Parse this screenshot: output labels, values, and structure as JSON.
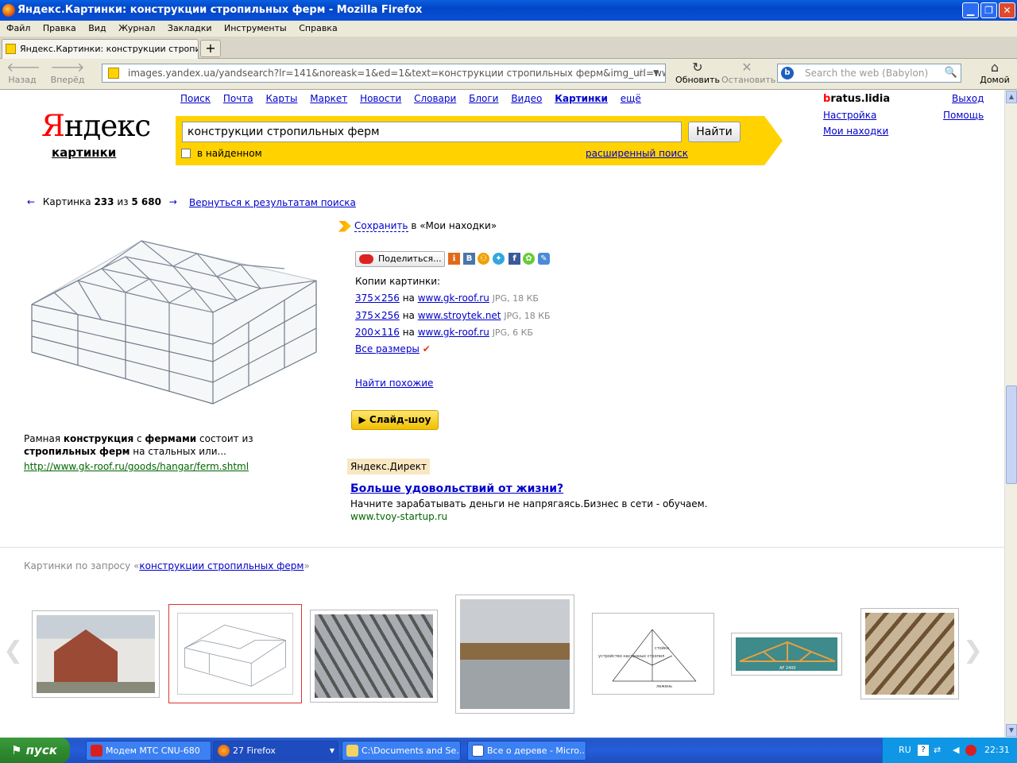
{
  "window": {
    "title": "Яндекс.Картинки: конструкции стропильных ферм - Mozilla Firefox",
    "minimize": "▁",
    "maximize": "❐",
    "close": "✕"
  },
  "menu": [
    "Файл",
    "Правка",
    "Вид",
    "Журнал",
    "Закладки",
    "Инструменты",
    "Справка"
  ],
  "tab": {
    "label": "Яндекс.Картинки: конструкции стропиль...",
    "new_tab": "+"
  },
  "toolbar": {
    "back": "Назад",
    "forward": "Вперёд",
    "reload": "Обновить",
    "stop": "Остановить",
    "home": "Домой",
    "url": "images.yandex.ua/yandsearch?lr=141&noreask=1&ed=1&text=конструкции стропильных ферм&img_url=ww",
    "search_placeholder": "Search the web (Babylon)"
  },
  "yandex": {
    "logo_first": "Я",
    "logo_rest": "ндекс",
    "logo_sub": "картинки",
    "nav": [
      "Поиск",
      "Почта",
      "Карты",
      "Маркет",
      "Новости",
      "Словари",
      "Блоги",
      "Видео",
      "Картинки",
      "ещё"
    ],
    "nav_active_index": 8,
    "query": "конструкции стропильных ферм",
    "search_button": "Найти",
    "in_found": "в найденном",
    "advanced": "расширенный поиск",
    "user_first": "b",
    "user_rest": "ratus.lidia",
    "exit": "Выход",
    "settings": "Настройка",
    "help": "Помощь",
    "my_finds": "Мои находки"
  },
  "viewer": {
    "prev_arrow": "←",
    "next_arrow": "→",
    "counter_label": "Картинка",
    "current": "233",
    "of": "из",
    "total": "5 680",
    "back_link": "Вернуться к результатам поиска",
    "desc_html": "Рамная <b>конструкция</b> с <b>фермами</b> состоит из <b>стропильных ферм</b> на стальных или...",
    "source_url": "http://www.gk-roof.ru/goods/hangar/ferm.shtml",
    "save_link": "Сохранить",
    "save_rest": "в «Мои находки»",
    "share": "Поделиться...",
    "copies_title": "Копии картинки:",
    "copies": [
      {
        "size": "375×256",
        "on": "на",
        "site": "www.gk-roof.ru",
        "meta": "JPG, 18 КБ"
      },
      {
        "size": "375×256",
        "on": "на",
        "site": "www.stroytek.net",
        "meta": "JPG, 18 КБ"
      },
      {
        "size": "200×116",
        "on": "на",
        "site": "www.gk-roof.ru",
        "meta": "JPG, 6 КБ"
      }
    ],
    "all_sizes": "Все размеры",
    "find_similar": "Найти похожие",
    "slideshow": "▶ Слайд-шоу"
  },
  "ad": {
    "label": "Яндекс.Директ",
    "title": "Больше удовольствий от жизни?",
    "text": "Начните зарабатывать деньги не напрягаясь.Бизнес в сети - обучаем.",
    "url": "www.tvoy-startup.ru"
  },
  "related": {
    "prefix": "Картинки по запросу «",
    "query": "конструкции стропильных ферм",
    "suffix": "»",
    "diagram_labels": {
      "left": "устройство наслонных стропил",
      "mid": "стойка",
      "bottom": "лежень",
      "span": "AF 2400"
    }
  },
  "taskbar": {
    "start": "пуск",
    "items": [
      "Модем МТС CNU-680",
      "27 Firefox",
      "C:\\Documents and Se...",
      "Все о дереве - Micro..."
    ],
    "lang": "RU",
    "time": "22:31"
  },
  "colors": {
    "link": "#0000cc",
    "yandex_yellow": "#ffd200",
    "yandex_red": "#ff0000",
    "green_url": "#006600"
  }
}
